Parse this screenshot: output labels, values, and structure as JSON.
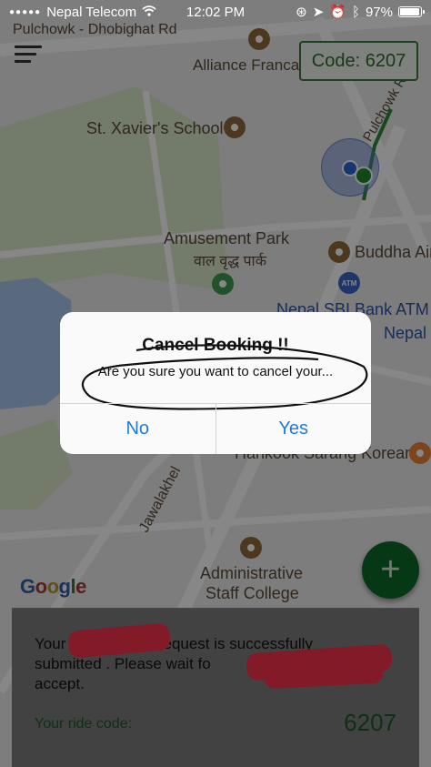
{
  "status_bar": {
    "carrier": "Nepal Telecom",
    "time": "12:02 PM",
    "battery": "97%",
    "battery_level": 0.97
  },
  "header": {
    "code_badge": "Code: 6207"
  },
  "map": {
    "streets": {
      "pulchowk_dhobighat": "Pulchowk - Dhobighat Rd",
      "pulchowk": "Pulchowk Rd",
      "jawalakhel": "Jawalakhel"
    },
    "places": {
      "alliance": "Alliance Franca",
      "st_xavier": "St. Xavier's School",
      "amusement_park": "Amusement Park",
      "amusement_park_nepali": "वाल वृद्ध पार्क",
      "buddha": "Buddha Air",
      "nepal_sbi_atm": "Nepal SBI Bank ATM",
      "nepal": "Nepal",
      "hankook": "Hankook Sarang Korean",
      "admin_college_line1": "Administrative",
      "admin_college_line2": "Staff College"
    },
    "atm_icon_text": "ATM",
    "google_logo": [
      "G",
      "o",
      "o",
      "g",
      "l",
      "e"
    ]
  },
  "alert": {
    "title": "Cancel Booking !!",
    "message": "Are you sure you want to cancel your...",
    "no_label": "No",
    "yes_label": "Yes"
  },
  "ride_card": {
    "message_line1_start": "Your",
    "message_line1_end": "request is successfully",
    "message_line2": "submitted . Please wait fo",
    "message_line3": "accept.",
    "code_label": "Your ride code:",
    "code_value": "6207"
  },
  "fab": {
    "icon": "plus-icon",
    "symbol": "+"
  },
  "colors": {
    "accent_green": "#1d5a27",
    "ios_blue": "#1f7be0",
    "redaction": "#f5344a"
  }
}
